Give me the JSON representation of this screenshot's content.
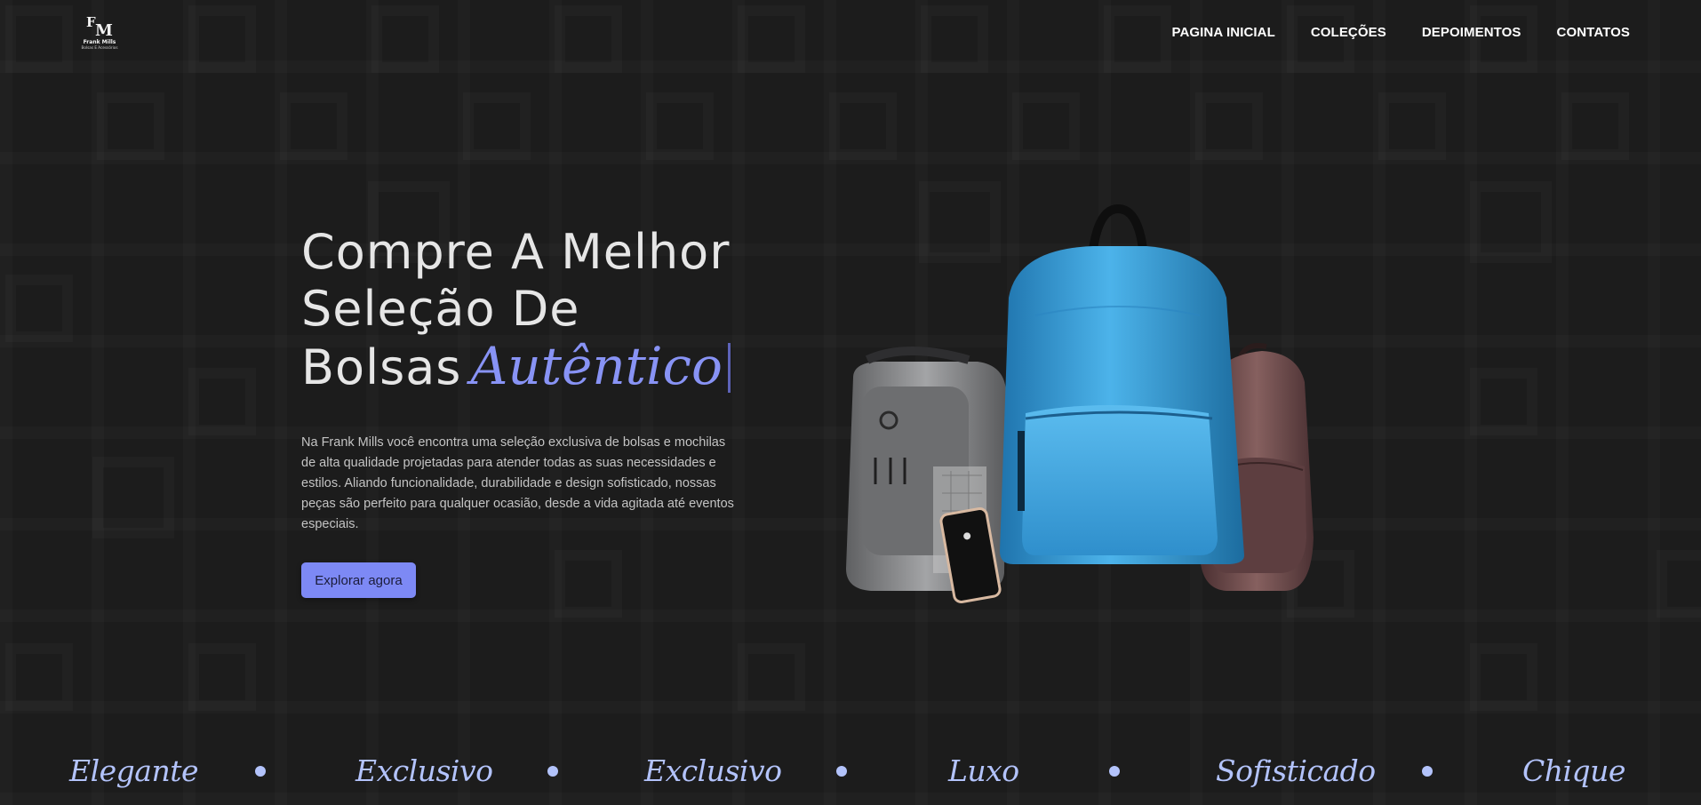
{
  "brand": {
    "monogram_f": "F",
    "monogram_m": "M",
    "name": "Frank Mills",
    "tagline": "Bolsas E Acessórios"
  },
  "nav": [
    {
      "label": "PAGINA INICIAL"
    },
    {
      "label": "COLEÇÕES"
    },
    {
      "label": "DEPOIMENTOS"
    },
    {
      "label": "CONTATOS"
    }
  ],
  "hero": {
    "title_line1": "Compre A Melhor",
    "title_line2": "Seleção De",
    "title_line3": "Bolsas",
    "title_accent": "Autêntico",
    "description": "Na Frank Mills você encontra uma seleção exclusiva de bolsas e mochilas de alta qualidade projetadas para atender todas as suas necessidades e estilos. Aliando funcionalidade, durabilidade e design sofisticado, nossas peças são perfeito para qualquer ocasião, desde a vida agitada até eventos especiais.",
    "cta_label": "Explorar agora"
  },
  "marquee": [
    {
      "label": "Elegante"
    },
    {
      "label": "Exclusivo"
    },
    {
      "label": "Exclusivo"
    },
    {
      "label": "Luxo"
    },
    {
      "label": "Sofisticado"
    },
    {
      "label": "Chique"
    }
  ],
  "colors": {
    "background": "#1c1c1c",
    "accent": "#7d89f5",
    "marquee": "#b3c3fb",
    "backpack_blue": "#3aa0dc",
    "backpack_brown": "#6e4a4c",
    "backpack_gray": "#8e8f91"
  }
}
